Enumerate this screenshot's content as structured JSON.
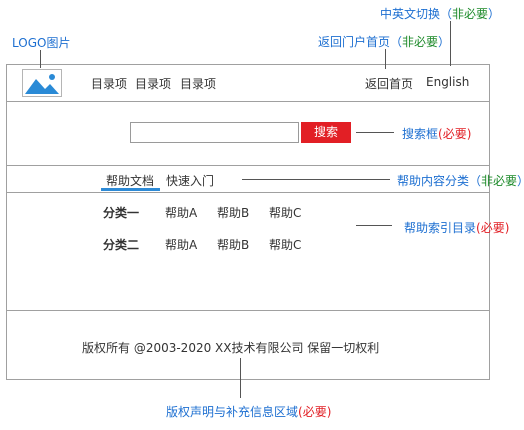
{
  "header": {
    "nav": [
      "目录项",
      "目录项",
      "目录项"
    ],
    "home_link": "返回首页",
    "lang_link": "English"
  },
  "search": {
    "button": "搜索",
    "placeholder": ""
  },
  "help_tabs": [
    "帮助文档",
    "快速入门"
  ],
  "help_index": [
    {
      "category": "分类一",
      "items": [
        "帮助A",
        "帮助B",
        "帮助C"
      ]
    },
    {
      "category": "分类二",
      "items": [
        "帮助A",
        "帮助B",
        "帮助C"
      ]
    }
  ],
  "footer": {
    "copyright": "版权所有 @2003-2020  XX技术有限公司 保留一切权利"
  },
  "annotations": {
    "logo": "LOGO图片",
    "lang_switch": {
      "text": "中英文切换（",
      "opt": "非必要",
      "end": "）"
    },
    "home": {
      "text": "返回门户首页（",
      "opt": "非必要",
      "end": "）"
    },
    "search": {
      "text": "搜索框",
      "req": "(必要)"
    },
    "help_tabs": {
      "text": "帮助内容分类（",
      "opt": "非必要",
      "end": "）"
    },
    "help_index": {
      "text": "帮助索引目录",
      "req": "(必要)"
    },
    "footer": {
      "text": "版权声明与补充信息区域",
      "req": "(必要)"
    }
  },
  "colors": {
    "accent_red": "#e21f25",
    "tab_underline": "#2d8ad6",
    "annotation_blue": "#1d6fd1",
    "annotation_green": "#1d8a2a",
    "border": "#a0a0a0"
  }
}
